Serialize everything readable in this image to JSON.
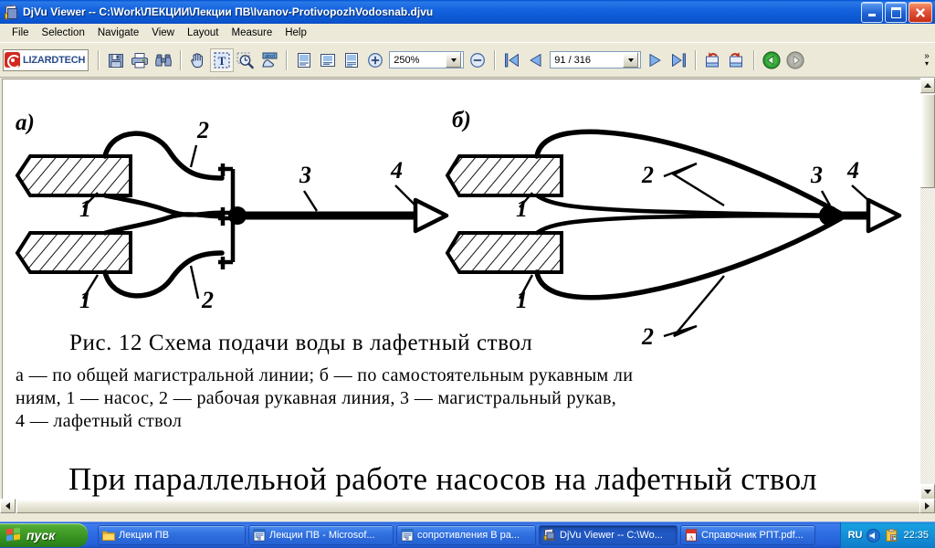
{
  "window": {
    "title": "DjVu Viewer -- C:\\Work\\ЛЕКЦИИ\\Лекции ПВ\\Ivanov-ProtivopozhVodosnab.djvu",
    "icon": "djvu-document-icon",
    "minimize_label": "Minimize",
    "maximize_label": "Restore",
    "close_label": "Close"
  },
  "menu": {
    "items": [
      {
        "label": "File"
      },
      {
        "label": "Selection"
      },
      {
        "label": "Navigate"
      },
      {
        "label": "View"
      },
      {
        "label": "Layout"
      },
      {
        "label": "Measure"
      },
      {
        "label": "Help"
      }
    ]
  },
  "toolbar": {
    "brand": "LIZARDTECH",
    "buttons": [
      {
        "name": "save-button",
        "icon": "floppy-disk-icon",
        "title": "Save"
      },
      {
        "name": "print-button",
        "icon": "printer-icon",
        "title": "Print"
      },
      {
        "name": "find-button",
        "icon": "binoculars-icon",
        "title": "Find"
      },
      {
        "name": "pan-tool-button",
        "icon": "hand-icon",
        "title": "Pan"
      },
      {
        "name": "text-select-button",
        "icon": "text-select-icon",
        "title": "Select Text"
      },
      {
        "name": "zoom-select-button",
        "icon": "zoom-rect-icon",
        "title": "Zoom Select"
      },
      {
        "name": "highlight-button",
        "icon": "highlight-hand-icon",
        "title": "Highlight"
      },
      {
        "name": "fit-page-button",
        "icon": "page-single-icon",
        "title": "Fit Page"
      },
      {
        "name": "fit-width-button",
        "icon": "page-width-icon",
        "title": "Fit Width"
      },
      {
        "name": "actual-size-button",
        "icon": "page-actual-icon",
        "title": "Actual Size"
      }
    ],
    "zoom_in": {
      "name": "zoom-in-button",
      "icon": "plus-circle-icon"
    },
    "zoom_out": {
      "name": "zoom-out-button",
      "icon": "minus-circle-icon"
    },
    "zoom_value": "250%",
    "page_value": "91 / 316",
    "nav": [
      {
        "name": "first-page-button",
        "icon": "first-page-arrow-icon"
      },
      {
        "name": "previous-page-button",
        "icon": "left-arrow-icon"
      },
      {
        "name": "next-page-button",
        "icon": "right-arrow-icon"
      },
      {
        "name": "last-page-button",
        "icon": "last-page-arrow-icon"
      },
      {
        "name": "rotate-left-button",
        "icon": "rotate-ccw-icon"
      },
      {
        "name": "rotate-right-button",
        "icon": "rotate-cw-icon"
      },
      {
        "name": "back-button",
        "icon": "green-back-arrow-icon"
      },
      {
        "name": "forward-button",
        "icon": "grey-forward-arrow-icon"
      }
    ],
    "overflow_label": "»"
  },
  "document": {
    "figure": {
      "panel_a_label": "а)",
      "panel_b_label": "б)",
      "callouts_a": [
        "2",
        "1",
        "1",
        "2",
        "3",
        "4"
      ],
      "callouts_b": [
        "2",
        "1",
        "1",
        "2",
        "3",
        "4"
      ]
    },
    "caption_title": "Рис. 12  Схема подачи воды в лафетный ствол",
    "caption_lines": [
      "а — по общей магистральной линии;  б — по самостоятельным рукавным ли",
      "ниям,  1 — насос,  2 — рабочая рукавная линия,   3 — магистральный рукав,",
      "4 — лафетный ствол"
    ],
    "body_heading": "При параллельной работе насосов на лафетный ствол"
  },
  "scrollbars": {
    "vertical_up": "▲",
    "vertical_down": "▼",
    "horizontal_left": "◄",
    "horizontal_right": "►"
  },
  "taskbar": {
    "start_label": "пуск",
    "tasks": [
      {
        "label": "Лекции ПВ",
        "icon": "folder-icon",
        "active": false
      },
      {
        "label": "Лекции ПВ - Microsof...",
        "icon": "word-doc-icon",
        "active": false
      },
      {
        "label": "сопротивления В ра...",
        "icon": "word-doc-icon",
        "active": false
      },
      {
        "label": "DjVu Viewer -- C:\\Wo...",
        "icon": "djvu-icon",
        "active": true
      },
      {
        "label": "Справочник РПТ.pdf...",
        "icon": "pdf-icon",
        "active": false
      }
    ],
    "tray": {
      "language": "RU",
      "icons": [
        "volume-icon",
        "clipboard-icon"
      ],
      "clock": "22:35"
    }
  },
  "colors": {
    "titlebar_blue": "#1463df",
    "chrome": "#ece9d8",
    "page_white": "#ffffff",
    "taskbar_blue": "#2f6ee4",
    "start_green": "#3c9624",
    "lizard_red": "#d02a1e",
    "brand_blue": "#2a4a8a"
  }
}
